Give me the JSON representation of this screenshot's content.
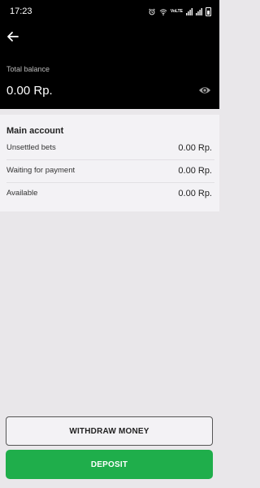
{
  "status_bar": {
    "time": "17:23",
    "icons": [
      "alarm-icon",
      "wifi-icon",
      "volte-icon",
      "signal-icon",
      "signal-icon",
      "battery-icon"
    ],
    "volte_text": "VoLTE"
  },
  "header": {
    "back_icon": "arrow-left-icon",
    "total_label": "Total balance",
    "total_value": "0.00 Rp.",
    "visibility_icon": "eye-icon"
  },
  "main_account": {
    "title": "Main account",
    "rows": [
      {
        "label": "Unsettled bets",
        "value": "0.00 Rp."
      },
      {
        "label": "Waiting for payment",
        "value": "0.00 Rp."
      },
      {
        "label": "Available",
        "value": "0.00 Rp."
      }
    ]
  },
  "actions": {
    "withdraw_label": "WITHDRAW MONEY",
    "deposit_label": "DEPOSIT"
  },
  "colors": {
    "header_bg": "#000000",
    "page_bg": "#e9e7ea",
    "card_bg": "#f3f2f5",
    "deposit_green": "#1fae4b"
  }
}
